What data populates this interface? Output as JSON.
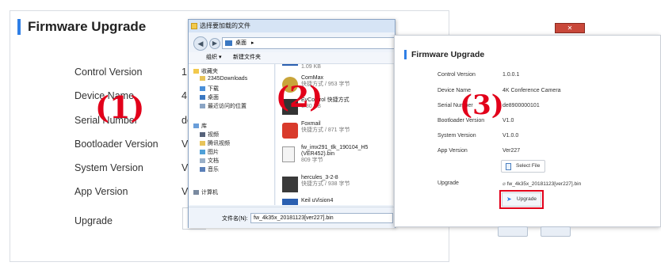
{
  "panel1": {
    "title": "Firmware Upgrade",
    "marker": "(1)",
    "rows": [
      {
        "label": "Control Version",
        "value": "1.0"
      },
      {
        "label": "Device Name",
        "value": "4K"
      },
      {
        "label": "Serial Number",
        "value": "de"
      },
      {
        "label": "Bootloader Version",
        "value": "V1"
      },
      {
        "label": "System Version",
        "value": "V1"
      },
      {
        "label": "App Version",
        "value": "Ve"
      },
      {
        "label": "Upgrade",
        "value": ""
      }
    ]
  },
  "panel2": {
    "window_title": "选择要加载的文件",
    "address": "桌面",
    "address_chevron": "▸",
    "marker": "(2)",
    "toolbar": {
      "organize": "组织 ▾",
      "new_folder": "新建文件夹"
    },
    "sidebar": [
      {
        "label": "收藏夹",
        "icon": "star-icon"
      },
      {
        "label": "2345Downloads",
        "icon": "folder-icon"
      },
      {
        "label": "下载",
        "icon": "download-icon"
      },
      {
        "label": "桌面",
        "icon": "desktop-icon"
      },
      {
        "label": "最近访问的位置",
        "icon": "recent-icon"
      },
      {
        "label": "库",
        "icon": "library-icon"
      },
      {
        "label": "视频",
        "icon": "video-icon"
      },
      {
        "label": "腾讯视频",
        "icon": "folder-icon"
      },
      {
        "label": "图片",
        "icon": "picture-icon"
      },
      {
        "label": "文档",
        "icon": "document-icon"
      },
      {
        "label": "音乐",
        "icon": "music-icon"
      },
      {
        "label": "计算机",
        "icon": "computer-icon"
      }
    ],
    "files": [
      {
        "name": "",
        "sub": "1.09 KB",
        "icon": "shortcut-icon"
      },
      {
        "name": "ComMax",
        "sub": "快捷方式 / 953 字节",
        "icon": "commax-icon"
      },
      {
        "name": "EyControl 快捷方式",
        "sub": "1.30 KB",
        "icon": "eycontrol-icon"
      },
      {
        "name": "Foxmail",
        "sub": "快捷方式 / 871 字节",
        "icon": "foxmail-icon"
      },
      {
        "name": "fw_imx291_tlk_190104_H5(VER452).bin",
        "sub": "809 字节",
        "icon": "bin-file-icon"
      },
      {
        "name": "hercules_3-2-8",
        "sub": "快捷方式 / 938 字节",
        "icon": "hercules-icon"
      },
      {
        "name": "Keil uVision4",
        "sub": "",
        "icon": "keil-icon"
      }
    ],
    "filename_label": "文件名(N):",
    "filename_value": "fw_4k35x_20181123[ver227].bin",
    "close_label": "✕"
  },
  "panel3": {
    "title": "Firmware Upgrade",
    "marker": "(3)",
    "rows": [
      {
        "label": "Control Version",
        "value": "1.0.0.1"
      },
      {
        "label": "Device Name",
        "value": "4K Conference Camera"
      },
      {
        "label": "Serial Number",
        "value": "de8900000101"
      },
      {
        "label": "Bootloader Version",
        "value": "V1.0"
      },
      {
        "label": "System Version",
        "value": "V1.0.0"
      },
      {
        "label": "App Version",
        "value": "Ver227"
      }
    ],
    "select_file": "Select File",
    "upgrade_label": "Upgrade",
    "file_name": "fw_4k35x_20181123[ver227].bin",
    "upgrade_button": "Upgrade"
  },
  "colors": {
    "accent": "#2f7fe6",
    "marker_red": "#e2001a",
    "dialog_blue": "#d6e4f5"
  }
}
